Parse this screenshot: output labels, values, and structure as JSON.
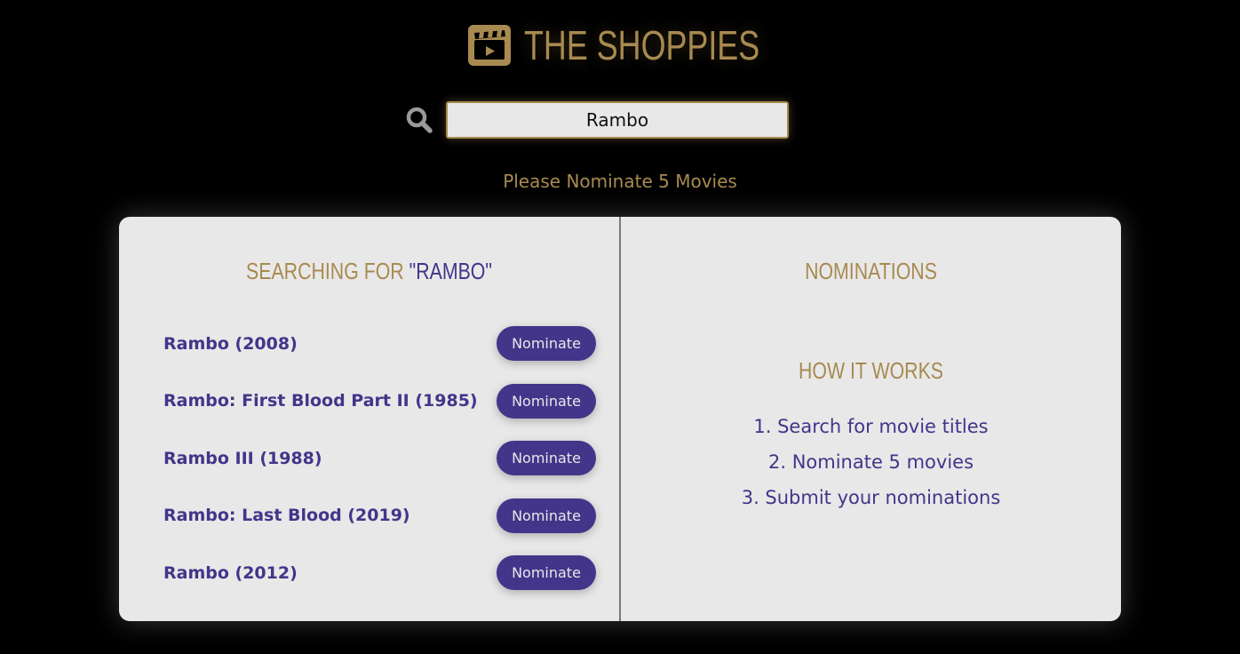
{
  "header": {
    "logo_icon": "clapperboard-icon",
    "title": "THE SHOPPIES",
    "accent_color": "#a88a50"
  },
  "search": {
    "icon": "search-icon",
    "value": "Rambo"
  },
  "instruction": "Please Nominate 5 Movies",
  "results_panel": {
    "heading_prefix": "SEARCHING FOR ",
    "heading_query": "\"RAMBO\"",
    "items": [
      {
        "title": "Rambo (2008)",
        "button_label": "Nominate"
      },
      {
        "title": "Rambo: First Blood Part II (1985)",
        "button_label": "Nominate"
      },
      {
        "title": "Rambo III (1988)",
        "button_label": "Nominate"
      },
      {
        "title": "Rambo: Last Blood (2019)",
        "button_label": "Nominate"
      },
      {
        "title": "Rambo (2012)",
        "button_label": "Nominate"
      }
    ]
  },
  "nominations_panel": {
    "heading": "NOMINATIONS",
    "how_heading": "HOW IT WORKS",
    "steps": [
      "1. Search for movie titles",
      "2. Nominate 5 movies",
      "3. Submit your nominations"
    ]
  },
  "colors": {
    "primary": "#42358a",
    "gold": "#a88a50",
    "panel_bg": "#e8e8e8"
  }
}
